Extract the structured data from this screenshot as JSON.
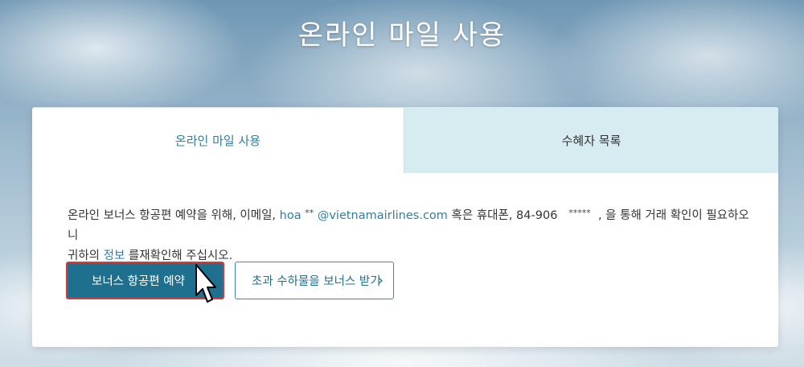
{
  "page": {
    "title": "온라인 마일 사용"
  },
  "tabs": [
    {
      "label": "온라인 마일 사용",
      "active": true
    },
    {
      "label": "수혜자 목록",
      "active": false
    }
  ],
  "message": {
    "part1": "온라인 보너스 항공편 예약을 위해, 이메일, ",
    "email_user": "hoa",
    "email_mask": "**",
    "email_domain": " @vietnamairlines.com",
    "part2": " 혹은 휴대폰, 84-906",
    "phone_mask": "*****",
    "part3": ", 을 통해 거래 확인이 필요하오니",
    "part4": "귀하의 ",
    "info_link": "정보",
    "part5": " 를재확인해 주십시오."
  },
  "buttons": {
    "book_bonus_flight": "보너스 항공편 예약",
    "excess_baggage": "초과 수하물을 보너스 받기",
    "chevron": "›"
  },
  "colors": {
    "primary": "#1f6f8f",
    "accent_link": "#2f7fa0",
    "highlight_border": "#d73a3a",
    "inactive_tab": "#d6ecf1"
  }
}
